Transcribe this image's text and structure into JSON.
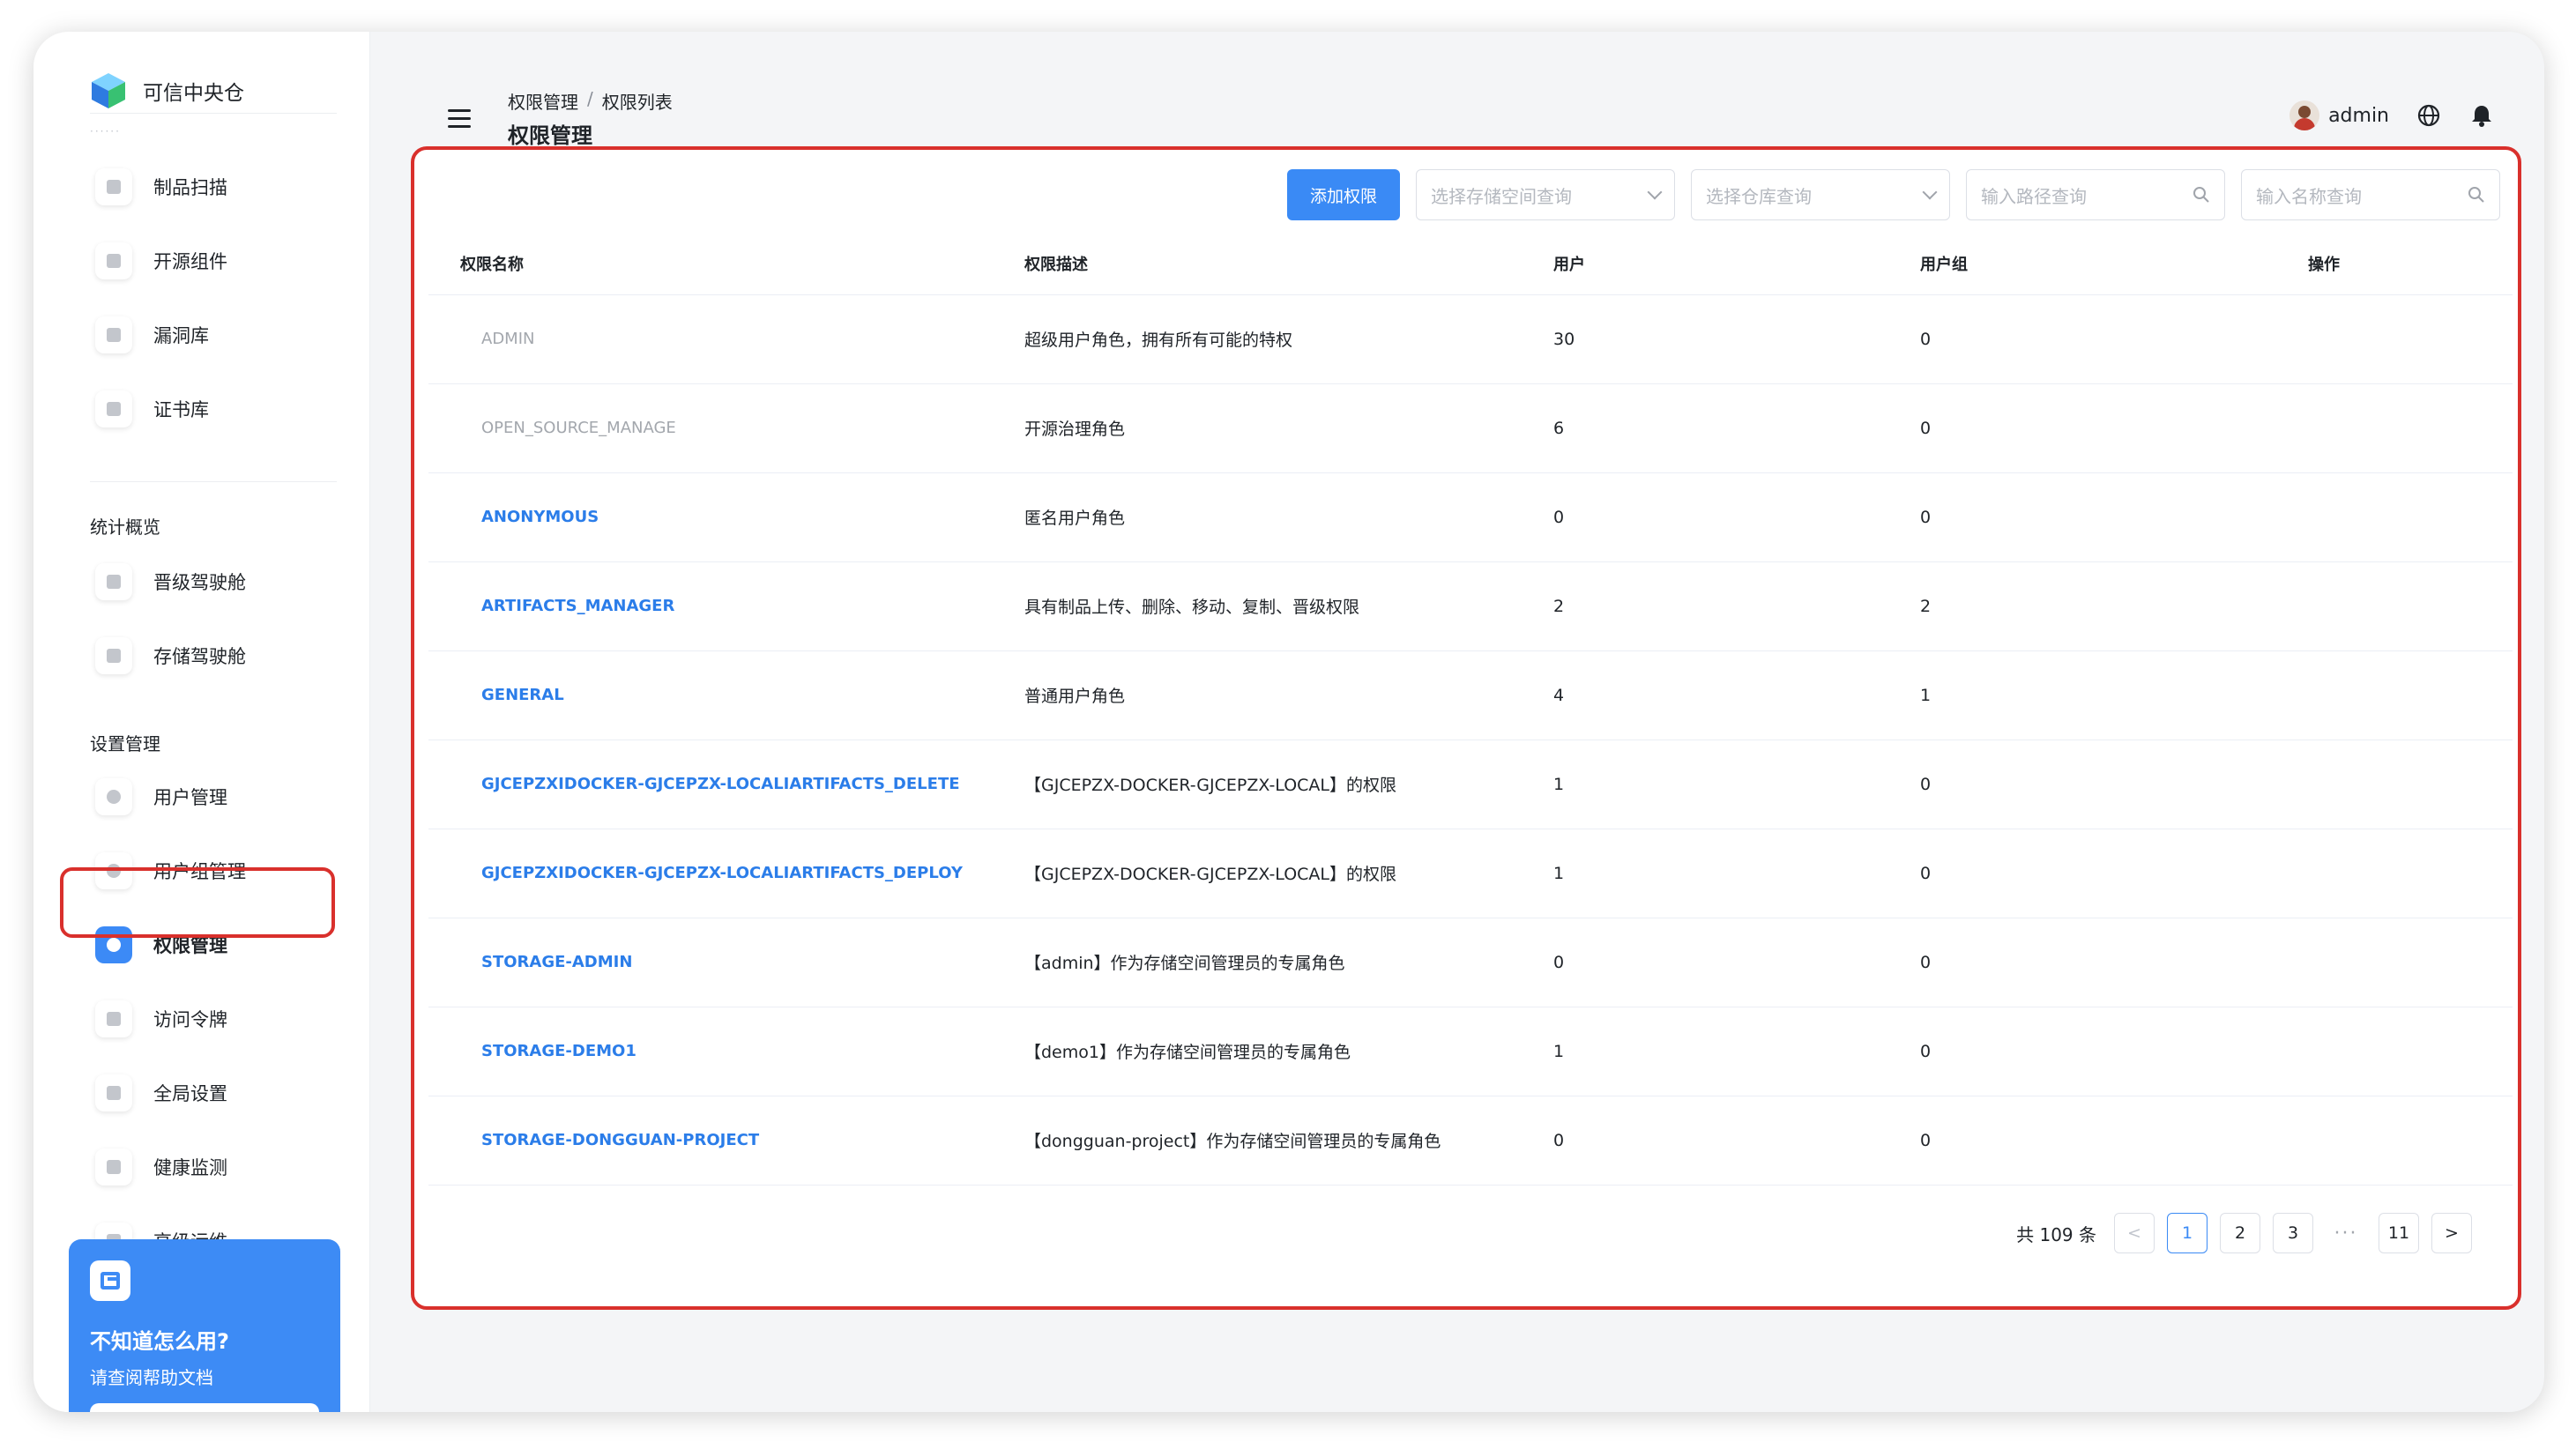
{
  "brand": {
    "name": "可信中央仓"
  },
  "sidebar": {
    "faded_label": "······",
    "group1": [
      {
        "label": "制品扫描"
      },
      {
        "label": "开源组件"
      },
      {
        "label": "漏洞库"
      },
      {
        "label": "证书库"
      }
    ],
    "section_stats": "统计概览",
    "group2": [
      {
        "label": "晋级驾驶舱"
      },
      {
        "label": "存储驾驶舱"
      }
    ],
    "section_settings": "设置管理",
    "group3": [
      {
        "label": "用户管理"
      },
      {
        "label": "用户组管理"
      },
      {
        "label": "权限管理"
      },
      {
        "label": "访问令牌"
      },
      {
        "label": "全局设置"
      },
      {
        "label": "健康监测"
      },
      {
        "label": "高级运维"
      }
    ],
    "help": {
      "title": "不知道怎么用?",
      "subtitle": "请查阅帮助文档"
    }
  },
  "header": {
    "breadcrumb": [
      "权限管理",
      "/",
      "权限列表"
    ],
    "title": "权限管理",
    "user": "admin"
  },
  "toolbar": {
    "add_label": "添加权限",
    "storage_placeholder": "选择存储空间查询",
    "repo_placeholder": "选择仓库查询",
    "path_placeholder": "输入路径查询",
    "name_placeholder": "输入名称查询"
  },
  "table": {
    "columns": [
      "权限名称",
      "权限描述",
      "用户",
      "用户组",
      "操作"
    ],
    "rows": [
      {
        "name": "ADMIN",
        "desc": "超级用户角色，拥有所有可能的特权",
        "users": "30",
        "groups": "0",
        "builtin": true
      },
      {
        "name": "OPEN_SOURCE_MANAGE",
        "desc": "开源治理角色",
        "users": "6",
        "groups": "0",
        "builtin": true
      },
      {
        "name": "ANONYMOUS",
        "desc": "匿名用户角色",
        "users": "0",
        "groups": "0",
        "builtin": false,
        "deletable": false
      },
      {
        "name": "ARTIFACTS_MANAGER",
        "desc": "具有制品上传、删除、移动、复制、晋级权限",
        "users": "2",
        "groups": "2",
        "builtin": false,
        "deletable": true
      },
      {
        "name": "GENERAL",
        "desc": "普通用户角色",
        "users": "4",
        "groups": "1",
        "builtin": false,
        "deletable": true
      },
      {
        "name": "GJCEPZXIDOCKER-GJCEPZX-LOCALIARTIFACTS_DELETE",
        "desc": "【GJCEPZX-DOCKER-GJCEPZX-LOCAL】的权限",
        "users": "1",
        "groups": "0",
        "builtin": false,
        "deletable": true
      },
      {
        "name": "GJCEPZXIDOCKER-GJCEPZX-LOCALIARTIFACTS_DEPLOY",
        "desc": "【GJCEPZX-DOCKER-GJCEPZX-LOCAL】的权限",
        "users": "1",
        "groups": "0",
        "builtin": false,
        "deletable": true
      },
      {
        "name": "STORAGE-ADMIN",
        "desc": "【admin】作为存储空间管理员的专属角色",
        "users": "0",
        "groups": "0",
        "builtin": false,
        "deletable": true
      },
      {
        "name": "STORAGE-DEMO1",
        "desc": "【demo1】作为存储空间管理员的专属角色",
        "users": "1",
        "groups": "0",
        "builtin": false,
        "deletable": true
      },
      {
        "name": "STORAGE-DONGGUAN-PROJECT",
        "desc": "【dongguan-project】作为存储空间管理员的专属角色",
        "users": "0",
        "groups": "0",
        "builtin": false,
        "deletable": true
      }
    ]
  },
  "pagination": {
    "total": "共 109 条",
    "prev": "<",
    "pages": [
      "1",
      "2",
      "3"
    ],
    "ellipsis": "···",
    "last": "11",
    "next": ">",
    "current": "1"
  },
  "colors": {
    "accent": "#3a8af5",
    "highlight": "#d9302c",
    "delete": "#e0352b"
  }
}
